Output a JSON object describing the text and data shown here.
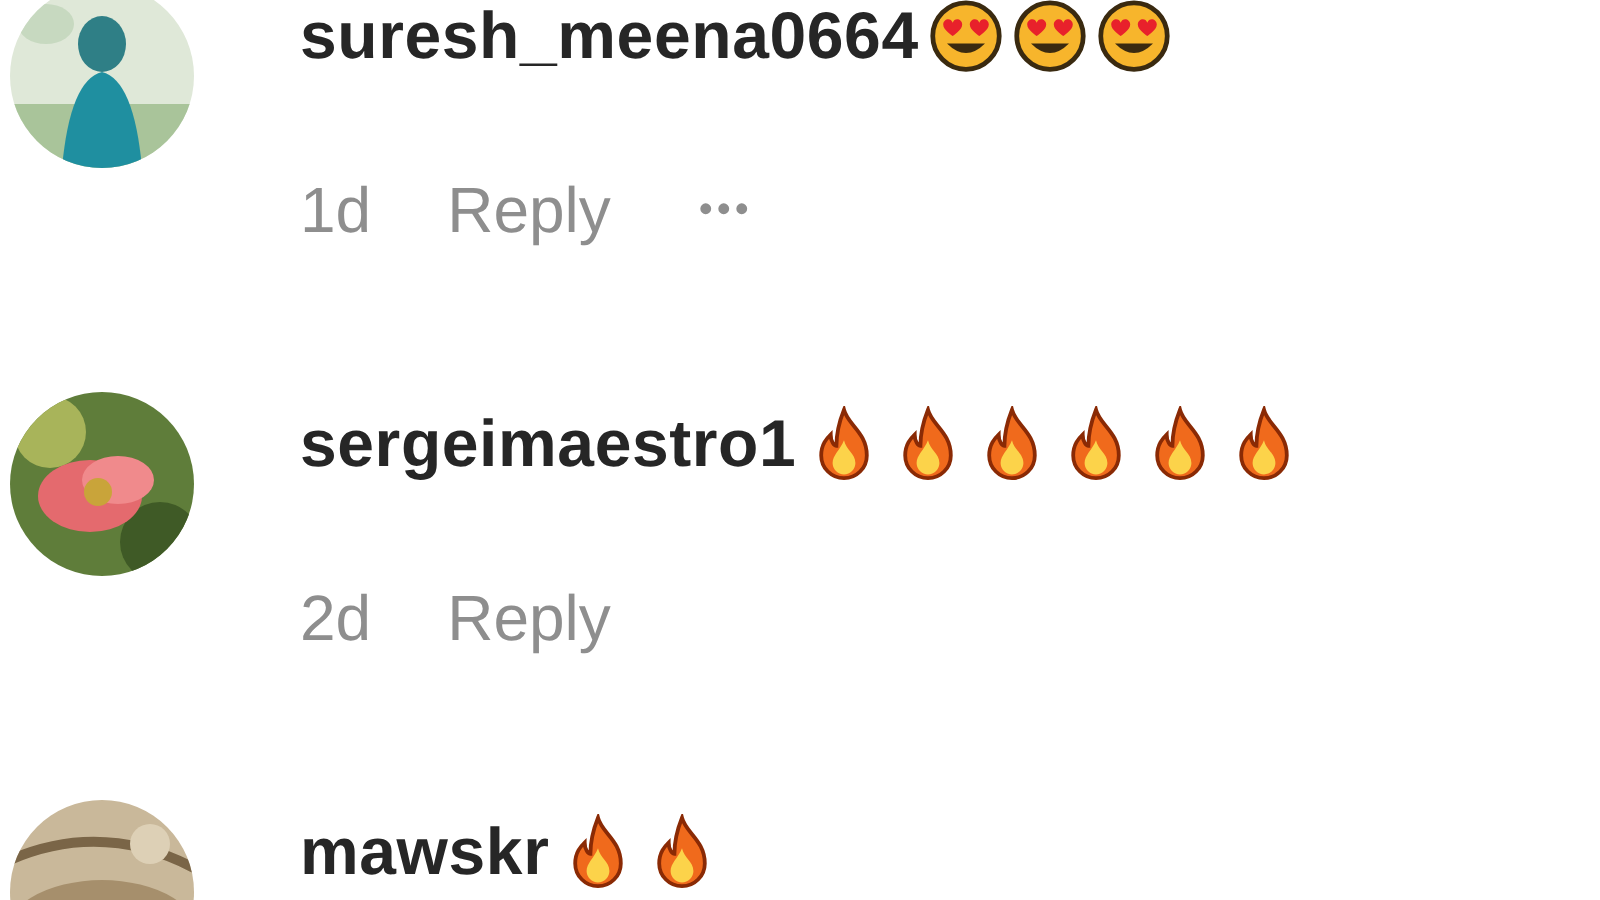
{
  "comments": [
    {
      "username": "suresh_meena0664",
      "emojis": [
        {
          "kind": "heart-eyes"
        },
        {
          "kind": "heart-eyes"
        },
        {
          "kind": "heart-eyes"
        }
      ],
      "time": "1d",
      "reply": "Reply",
      "more": "•••"
    },
    {
      "username": "sergeimaestro1",
      "emojis": [
        {
          "kind": "fire"
        },
        {
          "kind": "fire"
        },
        {
          "kind": "fire"
        },
        {
          "kind": "fire"
        },
        {
          "kind": "fire"
        },
        {
          "kind": "fire"
        }
      ],
      "time": "2d",
      "reply": "Reply"
    },
    {
      "username": "mawskr",
      "emojis": [
        {
          "kind": "fire"
        },
        {
          "kind": "fire"
        }
      ]
    }
  ]
}
